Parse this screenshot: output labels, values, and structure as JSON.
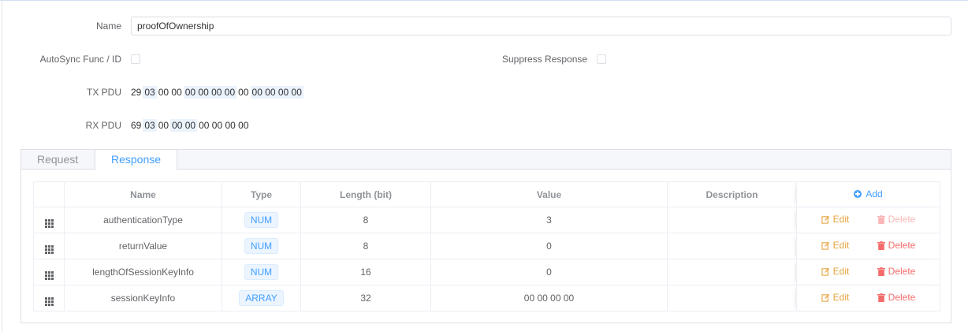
{
  "form": {
    "name_label": "Name",
    "name_value": "proofOfOwnership",
    "autosync_label": "AutoSync Func / ID",
    "suppress_label": "Suppress Response",
    "tx_label": "TX PDU",
    "tx_bytes": [
      "29",
      "03",
      "00 00",
      "00 00 00 00",
      "00",
      "00 00 00 00"
    ],
    "rx_label": "RX PDU",
    "rx_bytes": [
      "69",
      "03",
      "00",
      "00 00",
      "00 00 00 00"
    ]
  },
  "tabs": [
    {
      "label": "Request"
    },
    {
      "label": "Response"
    }
  ],
  "table": {
    "headers": {
      "name": "Name",
      "type": "Type",
      "length": "Length (bit)",
      "value": "Value",
      "description": "Description",
      "add": "Add"
    },
    "rows": [
      {
        "name": "authenticationType",
        "type": "NUM",
        "length": "8",
        "value": "3",
        "description": "",
        "edit": "Edit",
        "delete": "Delete",
        "delete_disabled": true
      },
      {
        "name": "returnValue",
        "type": "NUM",
        "length": "8",
        "value": "0",
        "description": "",
        "edit": "Edit",
        "delete": "Delete",
        "delete_disabled": false
      },
      {
        "name": "lengthOfSessionKeyInfo",
        "type": "NUM",
        "length": "16",
        "value": "0",
        "description": "",
        "edit": "Edit",
        "delete": "Delete",
        "delete_disabled": false
      },
      {
        "name": "sessionKeyInfo",
        "type": "ARRAY",
        "length": "32",
        "value": "00 00 00 00",
        "description": "",
        "edit": "Edit",
        "delete": "Delete",
        "delete_disabled": false
      }
    ]
  },
  "colors": {
    "accent": "#409eff",
    "edit": "#e6a23c",
    "delete": "#f56c6c",
    "delete_disabled": "#fab6b6"
  }
}
